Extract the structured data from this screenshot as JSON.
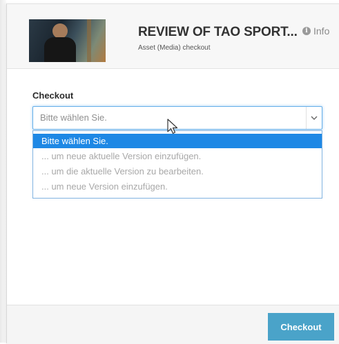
{
  "header": {
    "title": "REVIEW OF TAO SPORT...",
    "subtitle": "Asset (Media) checkout",
    "info_label": "Info",
    "info_icon": "info-circle-icon"
  },
  "form": {
    "field_label": "Checkout",
    "select": {
      "selected_value": "Bitte wählen Sie.",
      "options": [
        "Bitte wählen Sie.",
        "... um neue aktuelle Version einzufügen.",
        "... um die aktuelle Version zu bearbeiten.",
        "... um neue Version einzufügen."
      ],
      "highlighted_index": 0
    }
  },
  "footer": {
    "submit_label": "Checkout"
  },
  "colors": {
    "accent": "#1e88e5",
    "button": "#4aa3c9",
    "focus_border": "#66afe9"
  }
}
